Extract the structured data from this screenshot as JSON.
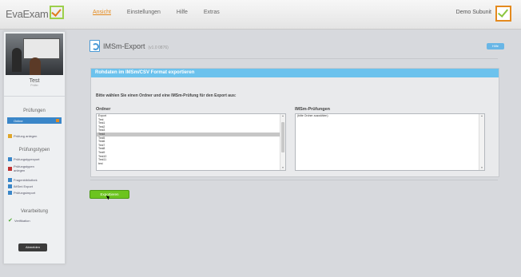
{
  "header": {
    "logo_text": "EvaExam",
    "logo_subtitle": "",
    "nav": [
      "Ansicht",
      "Einstellungen",
      "Hilfe",
      "Extras"
    ],
    "user_name": "Demo Subunit"
  },
  "sidebar": {
    "user_name": "Test",
    "user_role": "Prüfer",
    "section_pruefungen": "Prüfungen",
    "selected_item": "Online",
    "item_pruefung_anlegen": "Prüfung anlegen",
    "section_pruefungstypen": "Prüfungstypen",
    "items": [
      {
        "label": "Prüfungstypexport",
        "icon": "doc-icon",
        "color": "#3a86c8"
      },
      {
        "label": "Prüfungstypen anlegen",
        "icon": "doc-add-icon",
        "color": "#c03030"
      },
      {
        "label": "Fragenbibliothek",
        "icon": "library-icon",
        "color": "#3a86c8"
      },
      {
        "label": "IMSmi Export",
        "icon": "export-icon",
        "color": "#3a86c8"
      },
      {
        "label": "Prüfungsimport",
        "icon": "import-icon",
        "color": "#3a86c8"
      }
    ],
    "section_verarbeitung": "Verarbeitung",
    "item_verifikation": "Verifikation",
    "logout_label": "Abmelden"
  },
  "main": {
    "title": "IMSm-Export",
    "version": "(v1.0 0876)",
    "help_label": "Hilfe",
    "panel_heading": "Rohdaten im IMSm/CSV Format exportieren",
    "instruction": "Bitte wählen Sie einen Ordner und eine IMSm-Prüfung für den Export aus:",
    "folder_label": "Ordner",
    "folders": [
      "Export",
      "Test",
      "Test1",
      "Test2",
      "Test3",
      "Test4",
      "Test5",
      "Test6",
      "Test7",
      "Test8",
      "Test9",
      "Test10",
      "Test11",
      "test"
    ],
    "selected_folder_index": 5,
    "exams_label": "IMSm-Prüfungen",
    "exams": [
      "(bitte Ordner auswählen)"
    ],
    "export_button": "Exportieren"
  }
}
